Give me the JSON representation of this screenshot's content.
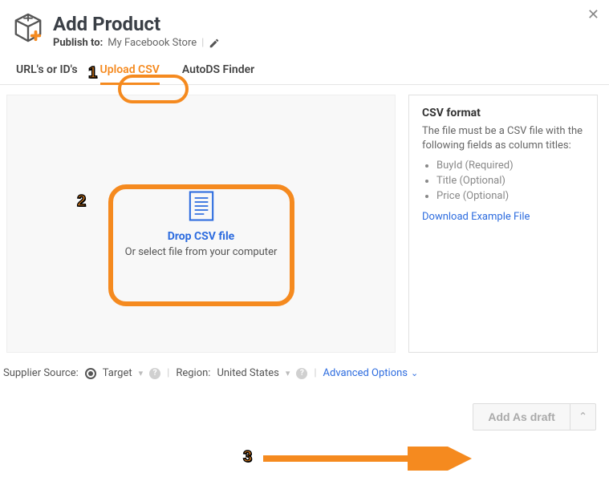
{
  "header": {
    "title": "Add Product",
    "publish_label": "Publish to:",
    "publish_target": "My Facebook Store"
  },
  "tabs": {
    "t1": "URL's or ID's",
    "t2": "Upload CSV",
    "t3": "AutoDS Finder",
    "active": "t2"
  },
  "dropzone": {
    "title": "Drop CSV file",
    "subtitle": "Or select file from your computer"
  },
  "csv_info": {
    "heading": "CSV format",
    "desc": "The file must be a CSV file with the following fields as column titles:",
    "fields": [
      "BuyId (Required)",
      "Title (Optional)",
      "Price (Optional)"
    ],
    "download_link": "Download Example File"
  },
  "footer": {
    "supplier_label": "Supplier Source:",
    "supplier_value": "Target",
    "region_label": "Region:",
    "region_value": "United States",
    "advanced": "Advanced Options"
  },
  "actions": {
    "add_draft": "Add As draft"
  },
  "annotations": {
    "n1": "1",
    "n2": "2",
    "n3": "3"
  }
}
